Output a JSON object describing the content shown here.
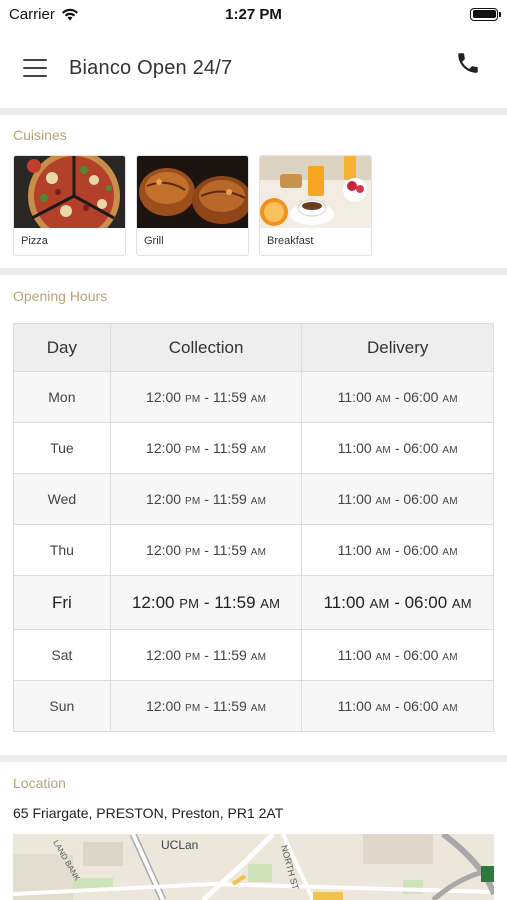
{
  "status_bar": {
    "carrier": "Carrier",
    "time": "1:27 PM"
  },
  "nav": {
    "title": "Bianco Open 24/7",
    "menu_icon": "hamburger-menu-icon",
    "phone_icon": "phone-icon"
  },
  "cuisines": {
    "label": "Cuisines",
    "items": [
      {
        "name": "Pizza"
      },
      {
        "name": "Grill"
      },
      {
        "name": "Breakfast"
      }
    ]
  },
  "opening_hours": {
    "label": "Opening Hours",
    "headers": {
      "day": "Day",
      "collection": "Collection",
      "delivery": "Delivery"
    },
    "rows": [
      {
        "day": "Mon",
        "collection": [
          "12:00",
          "PM",
          " - 11:59",
          "AM"
        ],
        "delivery": [
          "11:00",
          "AM",
          " - 06:00",
          "AM"
        ]
      },
      {
        "day": "Tue",
        "collection": [
          "12:00",
          "PM",
          " - 11:59",
          "AM"
        ],
        "delivery": [
          "11:00",
          "AM",
          " - 06:00",
          "AM"
        ]
      },
      {
        "day": "Wed",
        "collection": [
          "12:00",
          "PM",
          " - 11:59",
          "AM"
        ],
        "delivery": [
          "11:00",
          "AM",
          " - 06:00",
          "AM"
        ]
      },
      {
        "day": "Thu",
        "collection": [
          "12:00",
          "PM",
          " - 11:59",
          "AM"
        ],
        "delivery": [
          "11:00",
          "AM",
          " - 06:00",
          "AM"
        ]
      },
      {
        "day": "Fri",
        "collection": [
          "12:00",
          "PM",
          " - 11:59",
          "AM"
        ],
        "delivery": [
          "11:00",
          "AM",
          " - 06:00",
          "AM"
        ],
        "today": true
      },
      {
        "day": "Sat",
        "collection": [
          "12:00",
          "PM",
          " - 11:59",
          "AM"
        ],
        "delivery": [
          "11:00",
          "AM",
          " - 06:00",
          "AM"
        ]
      },
      {
        "day": "Sun",
        "collection": [
          "12:00",
          "PM",
          " - 11:59",
          "AM"
        ],
        "delivery": [
          "11:00",
          "AM",
          " - 06:00",
          "AM"
        ]
      }
    ]
  },
  "location": {
    "label": "Location",
    "address": "65 Friargate, PRESTON, Preston, PR1 2AT",
    "map_labels": {
      "area": "UCLan",
      "street1": "NORTH ST",
      "street2": "LAND BANK"
    }
  },
  "colors": {
    "section_label": "#b9a57a",
    "divider": "#ececec",
    "table_header_bg": "#eeeeee",
    "table_stripe": "#f7f7f7"
  }
}
